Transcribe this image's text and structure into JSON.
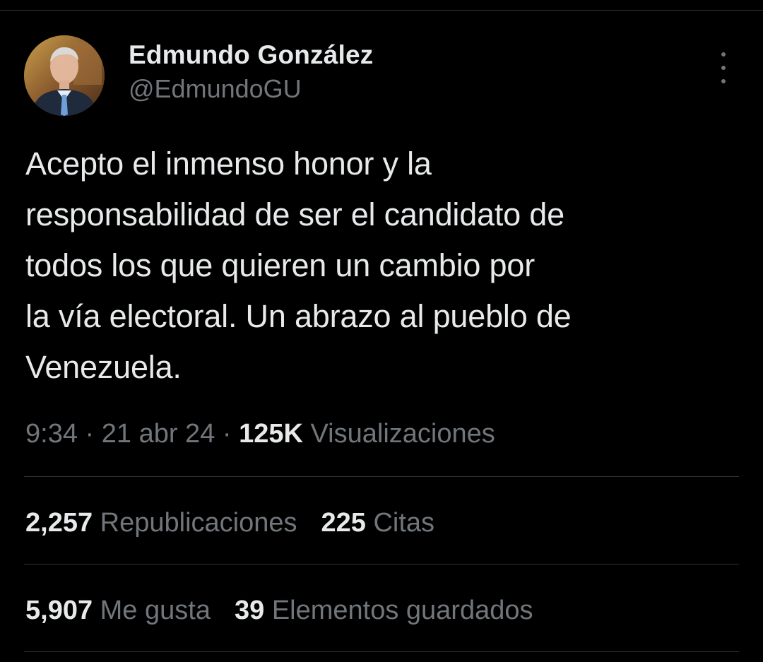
{
  "author": {
    "display_name": "Edmundo González",
    "handle": "@EdmundoGU"
  },
  "icons": {
    "avatar": "profile-photo",
    "more": "vertical-ellipsis-icon"
  },
  "tweet": {
    "text_lines": [
      "Acepto el inmenso honor y la",
      "responsabilidad de ser el candidato de",
      "todos los que quieren un cambio por",
      "la vía electoral. Un abrazo al pueblo de",
      "Venezuela."
    ]
  },
  "meta": {
    "time": "9:34",
    "separator": " · ",
    "date": "21 abr 24",
    "views_count": "125K",
    "views_label": "Visualizaciones"
  },
  "stats": {
    "reposts_count": "2,257",
    "reposts_label": "Republicaciones",
    "quotes_count": "225",
    "quotes_label": "Citas",
    "likes_count": "5,907",
    "likes_label": "Me gusta",
    "bookmarks_count": "39",
    "bookmarks_label": "Elementos guardados"
  },
  "colors": {
    "background": "#000000",
    "primary_text": "#e7e9ea",
    "secondary_text": "#71767b",
    "divider": "#2f3336"
  }
}
